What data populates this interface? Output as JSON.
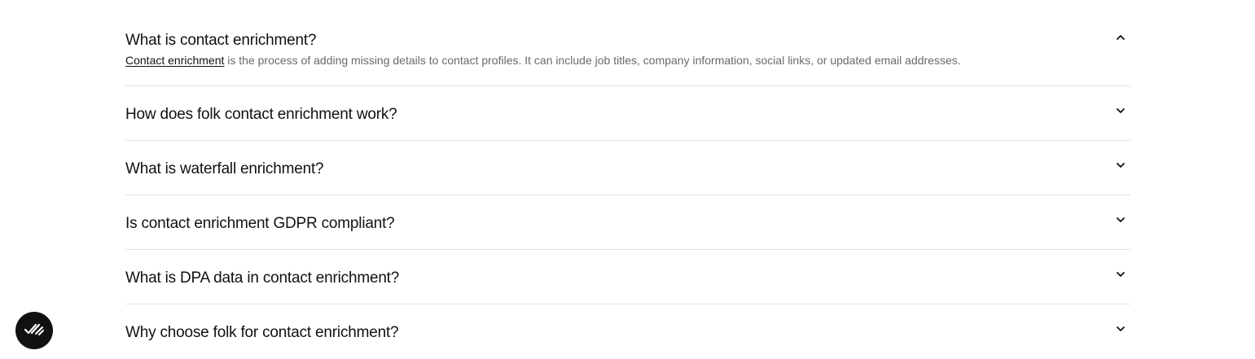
{
  "faq": {
    "items": [
      {
        "question": "What is contact enrichment?",
        "expanded": true,
        "answer_link": "Contact enrichment",
        "answer_rest": " is the process of adding missing details to contact profiles. It can include job titles, company information, social links, or updated email addresses."
      },
      {
        "question": "How does folk contact enrichment work?",
        "expanded": false
      },
      {
        "question": "What is waterfall enrichment?",
        "expanded": false
      },
      {
        "question": "Is contact enrichment GDPR compliant?",
        "expanded": false
      },
      {
        "question": "What is DPA data in contact enrichment?",
        "expanded": false
      },
      {
        "question": "Why choose folk for contact enrichment?",
        "expanded": false
      }
    ],
    "icons": {
      "expanded": "chevron-up-icon",
      "collapsed": "chevron-down-icon"
    }
  },
  "badge": {
    "icon": "check-marks-icon",
    "background": "#111111"
  },
  "colors": {
    "text": "#111111",
    "muted": "#6a6a6a",
    "divider": "#e3e3e3"
  }
}
